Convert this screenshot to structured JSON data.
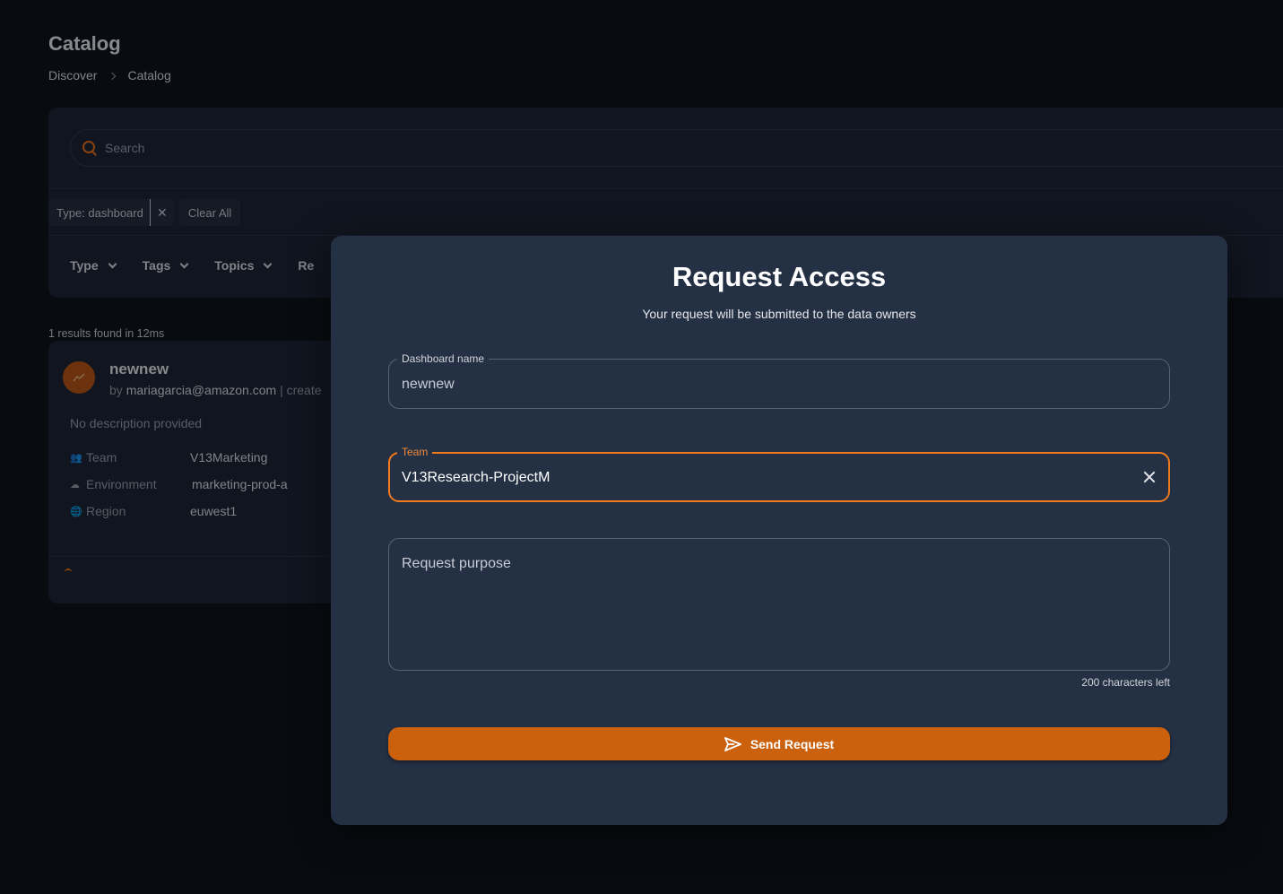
{
  "page": {
    "title": "Catalog",
    "breadcrumb": [
      "Discover",
      "Catalog"
    ]
  },
  "filters": {
    "search_placeholder": "Search",
    "active_chip": "Type: dashboard",
    "clear_all": "Clear All",
    "facets": [
      "Type",
      "Tags",
      "Topics",
      "Re"
    ]
  },
  "results": {
    "count_text": "1 results found in 12ms",
    "card": {
      "title": "newnew",
      "by_prefix": "by",
      "owner": "mariagarcia@amazon.com",
      "created_snippet": "| create",
      "description": "No description provided",
      "meta": [
        {
          "key": "Team",
          "value": "V13Marketing",
          "icon": "team-icon"
        },
        {
          "key": "Environment",
          "value": "marketing-prod-a",
          "icon": "cloud-icon"
        },
        {
          "key": "Region",
          "value": "euwest1",
          "icon": "globe-icon"
        }
      ]
    }
  },
  "modal": {
    "title": "Request Access",
    "subtitle": "Your request will be submitted to the data owners",
    "dashboard_name": {
      "label": "Dashboard name",
      "value": "newnew"
    },
    "team": {
      "label": "Team",
      "value": "V13Research-ProjectM"
    },
    "purpose": {
      "placeholder": "Request purpose",
      "chars_left": "200 characters left"
    },
    "send_label": "Send Request"
  },
  "colors": {
    "accent": "#cc610d",
    "focus_border": "#f07a1d",
    "modal_bg": "#243044",
    "page_bg": "#0b0f15"
  }
}
